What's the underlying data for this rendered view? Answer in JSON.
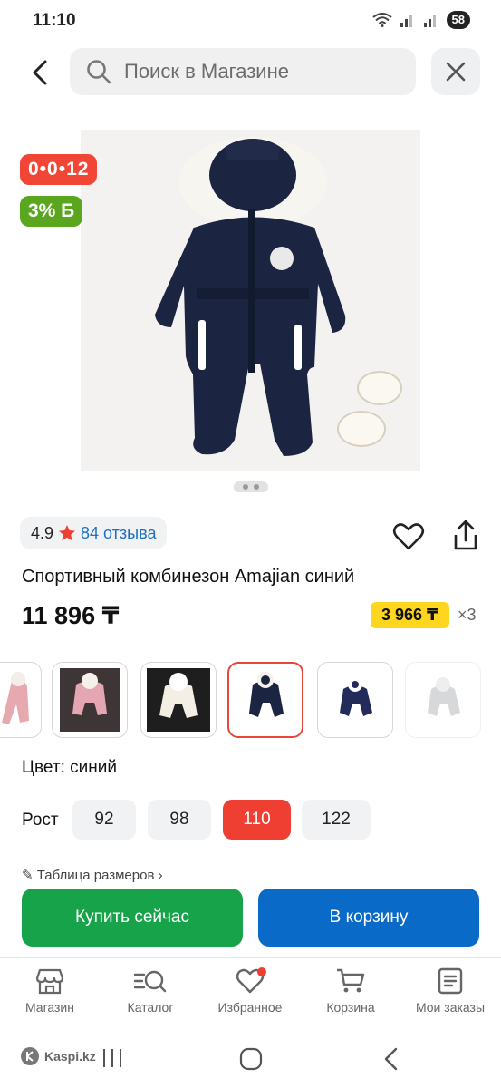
{
  "status": {
    "time": "11:10",
    "battery": "58"
  },
  "search": {
    "placeholder": "Поиск в Магазине"
  },
  "badges": {
    "timer": "0•0•12",
    "bonus": "3% Б"
  },
  "rating": {
    "value": "4.9",
    "reviews": "84 отзыва"
  },
  "product": {
    "title": "Спортивный комбинезон Amajian синий",
    "price": "11 896 ₸",
    "installment_price": "3 966 ₸",
    "installment_months": "×3"
  },
  "thumbnails": [
    {
      "name": "pink-variant"
    },
    {
      "name": "pink-photo-variant"
    },
    {
      "name": "white-variant"
    },
    {
      "name": "navy-variant",
      "selected": true
    },
    {
      "name": "navy-small-variant"
    },
    {
      "name": "grey-variant"
    }
  ],
  "color": {
    "label": "Цвет: синий"
  },
  "size": {
    "label": "Рост",
    "options": [
      "92",
      "98",
      "110",
      "122"
    ],
    "selected": "110"
  },
  "size_table": {
    "label": "Таблица размеров"
  },
  "actions": {
    "buy_now": "Купить сейчас",
    "add_to_cart": "В корзину"
  },
  "bottom_nav": [
    {
      "label": "Магазин",
      "icon": "store-icon"
    },
    {
      "label": "Каталог",
      "icon": "catalog-search-icon"
    },
    {
      "label": "Избранное",
      "icon": "heart-icon"
    },
    {
      "label": "Корзина",
      "icon": "cart-icon"
    },
    {
      "label": "Мои заказы",
      "icon": "orders-icon"
    }
  ],
  "system": {
    "brand": "Kaspi.kz"
  },
  "colors": {
    "accent_red": "#ef3e32",
    "green": "#17a34a",
    "blue": "#0a6ac8",
    "yellow": "#ffd61f",
    "link": "#1e6fc5"
  }
}
